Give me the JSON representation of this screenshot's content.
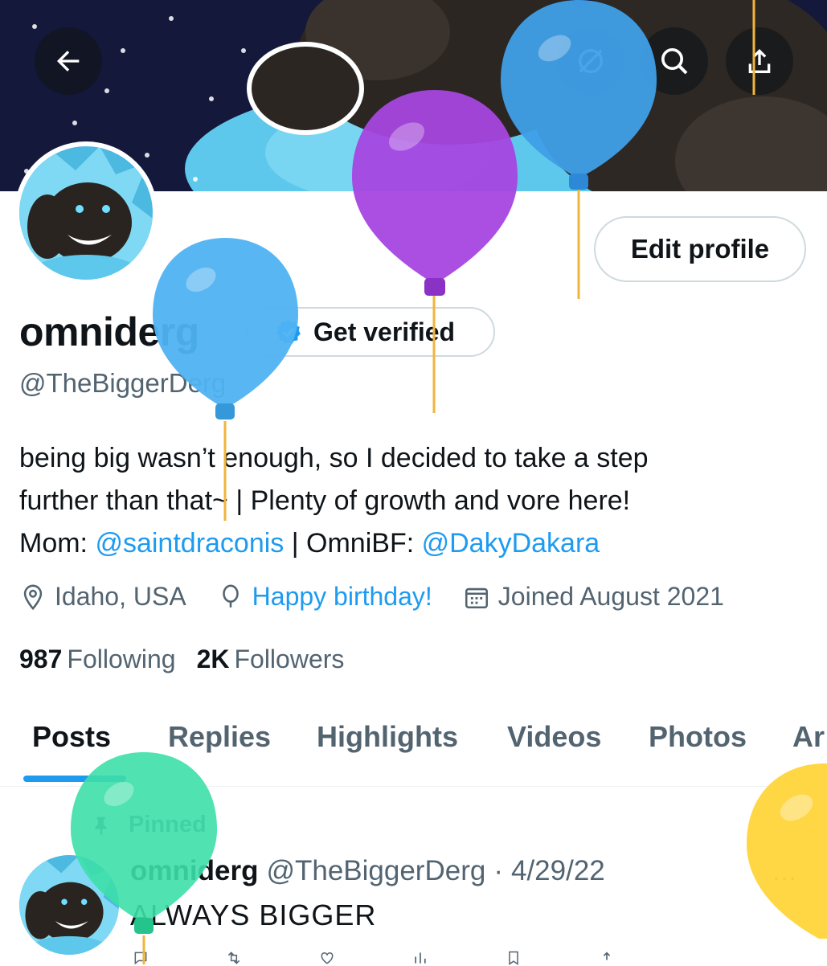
{
  "header": {
    "back_icon": "arrow-left-icon",
    "hidden_icon": "eye-slash-icon",
    "search_icon": "search-icon",
    "share_icon": "share-icon"
  },
  "profile": {
    "edit_button": "Edit profile",
    "display_name": "omniderg",
    "get_verified": "Get verified",
    "handle": "@TheBiggerDerg",
    "bio_line1": "being big wasn’t enough, so I decided to take a step",
    "bio_line2": "further than that~ | Plenty of growth and vore here!",
    "bio_mom_label": "Mom: ",
    "bio_mom_link": "@saintdraconis",
    "bio_sep": " | OmniBF: ",
    "bio_bf_link": "@DakyDakara",
    "location": "Idaho, USA",
    "birthday": "Happy birthday!",
    "joined": "Joined August 2021",
    "following_count": "987",
    "following_label": "Following",
    "followers_count": "2K",
    "followers_label": "Followers"
  },
  "tabs": [
    {
      "label": "Posts"
    },
    {
      "label": "Replies"
    },
    {
      "label": "Highlights"
    },
    {
      "label": "Videos"
    },
    {
      "label": "Photos"
    },
    {
      "label": "Ar"
    }
  ],
  "post": {
    "pinned_label": "Pinned",
    "author_name": "omniderg",
    "author_handle": "@TheBiggerDerg",
    "dot": "·",
    "date": "4/29/22",
    "more": "…",
    "text": "ALWAYS BIGGER"
  },
  "colors": {
    "accent": "#1d9bf0",
    "secondary_text": "#536471",
    "balloon_purple": "#a646e0",
    "balloon_blue": "#3f9fe8",
    "balloon_lightblue": "#4fb3f2",
    "balloon_green": "#3ddfa8",
    "balloon_yellow": "#ffd43a"
  }
}
